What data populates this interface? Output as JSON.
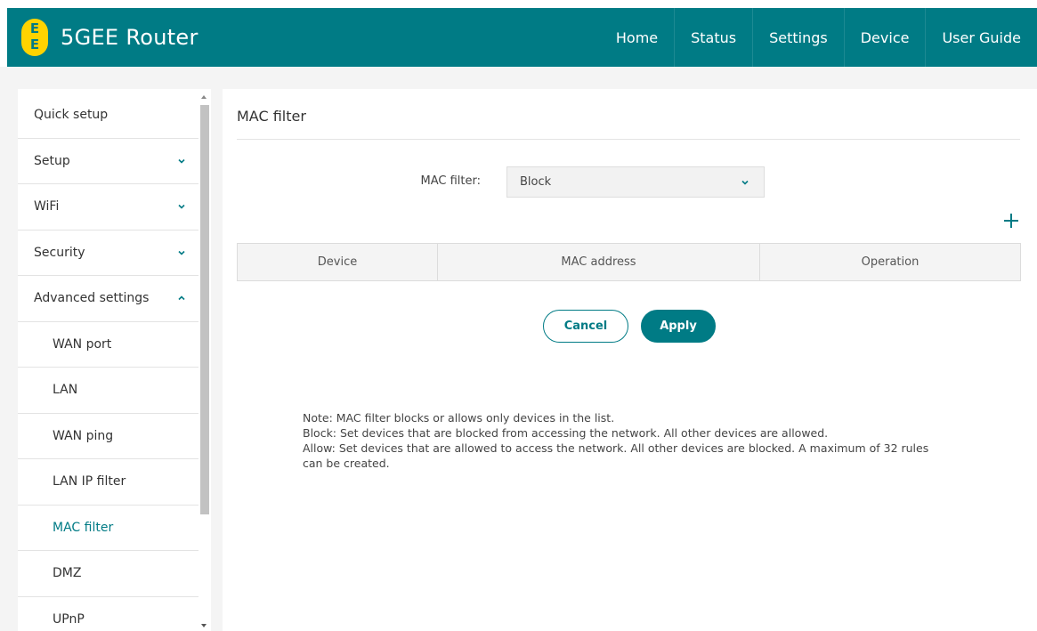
{
  "header": {
    "logo_top": "E",
    "logo_bottom": "E",
    "title": "5GEE Router",
    "nav": [
      "Home",
      "Status",
      "Settings",
      "Device",
      "User Guide"
    ]
  },
  "sidebar": {
    "items": [
      {
        "label": "Quick setup"
      },
      {
        "label": "Setup"
      },
      {
        "label": "WiFi"
      },
      {
        "label": "Security"
      },
      {
        "label": "Advanced settings"
      },
      {
        "label": "WAN port"
      },
      {
        "label": "LAN"
      },
      {
        "label": "WAN ping"
      },
      {
        "label": "LAN IP filter"
      },
      {
        "label": "MAC filter"
      },
      {
        "label": "DMZ"
      },
      {
        "label": "UPnP"
      }
    ],
    "active_item": "MAC filter"
  },
  "main": {
    "title": "MAC filter",
    "filter_label": "MAC filter:",
    "filter_value": "Block",
    "table_headers": [
      "Device",
      "MAC address",
      "Operation"
    ],
    "cancel_label": "Cancel",
    "apply_label": "Apply",
    "note_lines": [
      "Note: MAC filter blocks or allows only devices in the list.",
      "Block: Set devices that are blocked from accessing the network. All other devices are allowed.",
      "Allow: Set devices that are allowed to access the network. All other devices are blocked. A maximum of 32 rules can be created."
    ]
  },
  "colors": {
    "brand": "#007b85",
    "logo": "#ffd300",
    "background": "#f4f4f4"
  },
  "icons": [
    "chevron-down-icon",
    "chevron-up-icon",
    "plus-icon"
  ]
}
